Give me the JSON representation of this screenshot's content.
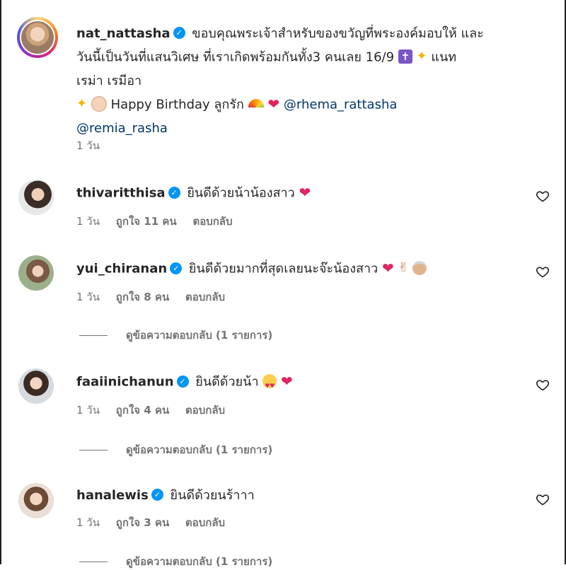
{
  "post": {
    "username": "nat_nattasha",
    "caption_line1": "ขอบคุณพระเจ้าสำหรับของขวัญที่พระองค์มอบให้ และ",
    "caption_line2": "วันนี้เป็นวันที่แสนวิเศษ ที่เราเกิดพร้อมกันทั้ง3 คนเลย 16/9",
    "caption_line2b": "แนท",
    "caption_line3": "เรม่า เรมีอา",
    "caption_line4": "Happy Birthday ลูกรัก",
    "mention1": "@rhema_rattasha",
    "mention2": "@remia_rasha",
    "time": "1 วัน"
  },
  "comments": [
    {
      "username": "thivaritthisa",
      "text": "ยินดีด้วยน้าน้องสาว",
      "time": "1 วัน",
      "likes": "ถูกใจ 11 คน",
      "reply": "ตอบกลับ"
    },
    {
      "username": "yui_chiranan",
      "text": "ยินดีด้วยมากที่สุดเลยนะจ๊ะน้องสาว",
      "time": "1 วัน",
      "likes": "ถูกใจ 8 คน",
      "reply": "ตอบกลับ",
      "view_replies": "ดูข้อความตอบกลับ (1 รายการ)"
    },
    {
      "username": "faaiinichanun",
      "text": "ยินดีด้วยน้า",
      "time": "1 วัน",
      "likes": "ถูกใจ 4 คน",
      "reply": "ตอบกลับ",
      "view_replies": "ดูข้อความตอบกลับ (1 รายการ)"
    },
    {
      "username": "hanalewis",
      "text": "ยินดีด้วยนร้าาา",
      "time": "1 วัน",
      "likes": "ถูกใจ 3 คน",
      "reply": "ตอบกลับ",
      "view_replies": "ดูข้อความตอบกลับ (1 รายการ)"
    }
  ],
  "icons": {
    "verified": "verified-badge-icon",
    "like": "heart-outline-icon"
  },
  "colors": {
    "text": "#262626",
    "muted": "#737373",
    "mention": "#00376b",
    "verified": "#0095f6"
  }
}
